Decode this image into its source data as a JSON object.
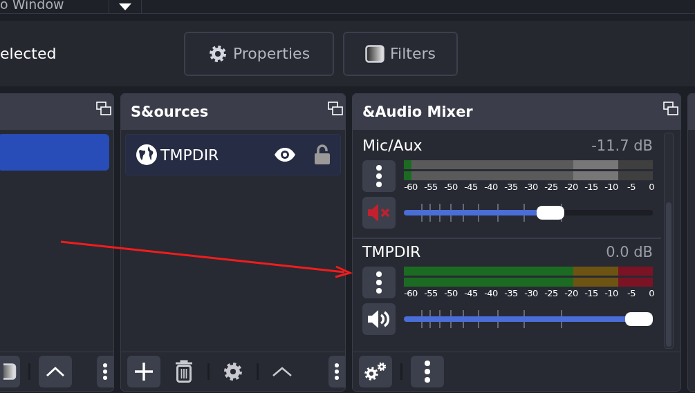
{
  "top_bar": {
    "text": "o Window"
  },
  "context_bar": {
    "label": "elected",
    "buttons": [
      {
        "label": "Properties",
        "kind": "gear"
      },
      {
        "label": "Filters",
        "kind": "filter"
      }
    ]
  },
  "scenes": {
    "items": [
      {
        "selected": true
      }
    ]
  },
  "sources": {
    "title": "S&ources",
    "items": [
      {
        "name": "TMPDIR",
        "selected": true,
        "visible": true,
        "locked": false
      }
    ]
  },
  "audio_mixer": {
    "title": "&Audio Mixer",
    "channels": [
      {
        "name": "Mic/Aux",
        "reading": "-11.7 dB",
        "muted": true,
        "meter": {
          "level": 0.03
        },
        "fader": {
          "level": 0.6
        },
        "scale": [
          "-60",
          "-55",
          "-50",
          "-45",
          "-40",
          "-35",
          "-30",
          "-25",
          "-20",
          "-15",
          "-10",
          "-5",
          "0"
        ]
      },
      {
        "name": "TMPDIR",
        "reading": "0.0 dB",
        "muted": false,
        "meter": {
          "level": 1
        },
        "fader": {
          "level": 1
        },
        "scale": [
          "-60",
          "-55",
          "-50",
          "-45",
          "-40",
          "-35",
          "-30",
          "-25",
          "-20",
          "-15",
          "-10",
          "-5",
          "0"
        ]
      }
    ]
  }
}
